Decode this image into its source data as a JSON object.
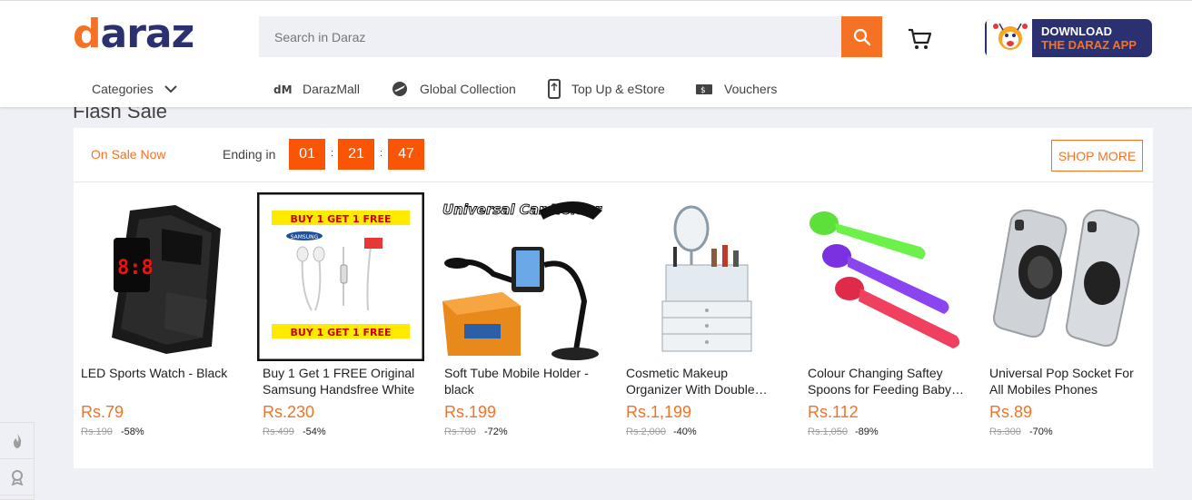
{
  "header": {
    "logo_first": "d",
    "logo_rest": "araz",
    "search_placeholder": "Search in Daraz",
    "app_banner_line1": "DOWNLOAD",
    "app_banner_line2": "THE DARAZ APP"
  },
  "nav": {
    "categories": "Categories",
    "items": [
      {
        "label": "DarazMall",
        "icon": "darazmall-icon"
      },
      {
        "label": "Global Collection",
        "icon": "plane-globe-icon"
      },
      {
        "label": "Top Up & eStore",
        "icon": "phone-topup-icon"
      },
      {
        "label": "Vouchers",
        "icon": "voucher-icon"
      }
    ]
  },
  "flash_sale": {
    "title": "Flash Sale",
    "on_sale": "On Sale Now",
    "ending_label": "Ending in",
    "timer": {
      "h": "01",
      "m": "21",
      "s": "47"
    },
    "shop_more": "SHOP MORE",
    "products": [
      {
        "name": "LED Sports Watch - Black",
        "price": "Rs.79",
        "old_price": "Rs.190",
        "discount": "-58%",
        "image": "led-watch-image"
      },
      {
        "name": "Buy 1 Get 1 FREE Original Samsung Handsfree White",
        "price": "Rs.230",
        "old_price": "Rs.499",
        "discount": "-54%",
        "image": "handsfree-image",
        "badge_text": "BUY 1 GET 1 FREE",
        "brand": "SAMSUNG"
      },
      {
        "name": "Soft Tube Mobile Holder - black",
        "price": "Rs.199",
        "old_price": "Rs.700",
        "discount": "-72%",
        "image": "car-holder-image",
        "image_text": "Universal Car Holder"
      },
      {
        "name": "Cosmetic Makeup Organizer With Double Mirror",
        "price": "Rs.1,199",
        "old_price": "Rs.2,000",
        "discount": "-40%",
        "image": "makeup-organizer-image"
      },
      {
        "name": "Colour Changing Saftey Spoons for Feeding Baby Set",
        "price": "Rs.112",
        "old_price": "Rs.1,050",
        "discount": "-89%",
        "image": "baby-spoons-image"
      },
      {
        "name": "Universal Pop Socket For All Mobiles Phones",
        "price": "Rs.89",
        "old_price": "Rs.300",
        "discount": "-70%",
        "image": "pop-socket-image"
      }
    ]
  },
  "colors": {
    "accent": "#f57224",
    "brand_navy": "#2b3070",
    "timer_bg": "#f85606"
  }
}
